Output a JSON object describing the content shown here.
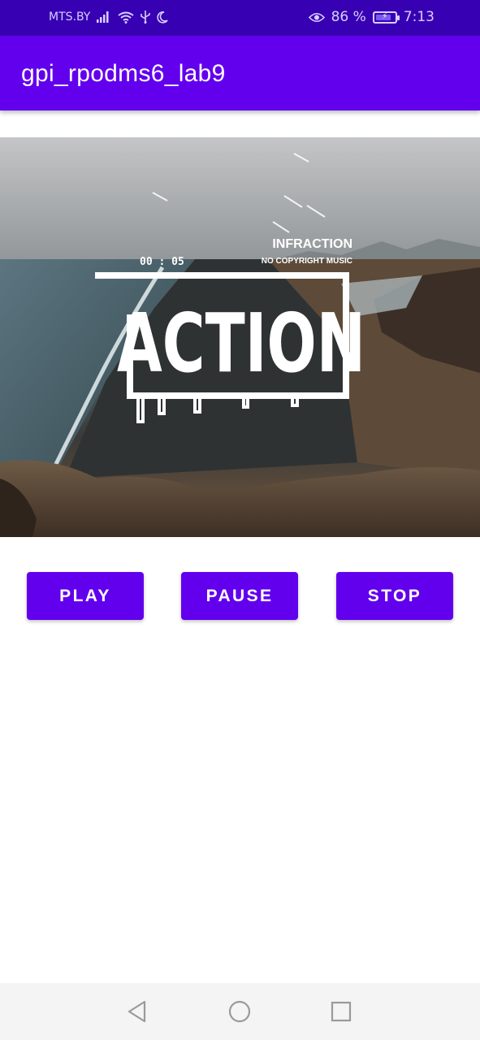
{
  "status_bar": {
    "carrier": "MTS.BY",
    "battery_percent": "86 %",
    "battery_level": 0.86,
    "time": "7:13",
    "icons": [
      "signal-icon",
      "wifi-icon",
      "usb-icon",
      "moon-icon",
      "eye-icon",
      "battery-icon"
    ]
  },
  "app_bar": {
    "title": "gpi_rpodms6_lab9",
    "color": "#6200ee"
  },
  "video": {
    "timer": "00 : 05",
    "title": "ACTION",
    "brand": "INFRACTION",
    "brand_sub": "NO COPYRIGHT MUSIC"
  },
  "controls": {
    "play_label": "PLAY",
    "pause_label": "PAUSE",
    "stop_label": "STOP"
  },
  "nav_bar": {
    "icons": [
      "back-icon",
      "home-icon",
      "recents-icon"
    ]
  },
  "colors": {
    "primary": "#6200ee",
    "primary_dark": "#3700b3"
  }
}
